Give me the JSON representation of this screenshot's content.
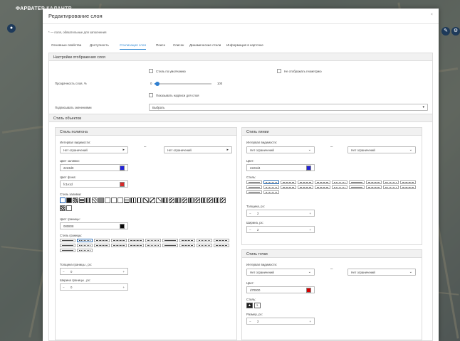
{
  "map": {
    "title": "ФАРВАТЕР КАЛАНТР"
  },
  "modal": {
    "title": "Редактирование слоя",
    "close_icon": "×",
    "required_note": "* — поля, обязательные для заполнения",
    "tabs": [
      {
        "label": "Основные свойства"
      },
      {
        "label": "Доступность"
      },
      {
        "label": "Стилизация слоя"
      },
      {
        "label": "Поиск"
      },
      {
        "label": "Список"
      },
      {
        "label": "Динамические стили"
      },
      {
        "label": "Информация в карточке"
      }
    ],
    "active_tab": "Стилизация слоя"
  },
  "display": {
    "title": "Настройки отображения слоя",
    "default_style": "Стиль по умолчанию",
    "hide_geometry": "Не отображать геометрию",
    "opacity_label": "Прозрачность слоя, %",
    "opacity_min": "0",
    "opacity_max": "100",
    "opacity_value": 0.04,
    "show_labels": "Показывать надписи для слоя",
    "sign_label": "Подписывать значениями",
    "sign_value": "Выбрать"
  },
  "objects": {
    "title": "Стиль объектов"
  },
  "polygon": {
    "title": "Стиль полигона",
    "visibility_label": "Интервал видимости:",
    "vis_from": "Нет ограничений",
    "vis_to": "Нет ограничений",
    "fill_label": "Цвет заливки:",
    "fill_value": "2223d9",
    "fill_color": "#2223d9",
    "bg_label": "Цвет фона:",
    "bg_value": "fc1e1d",
    "bg_color": "#d92b2b",
    "fillstyle_label": "Стиль заливки:",
    "border_color_label": "Цвет границы:",
    "border_color_value": "080808",
    "border_color": "#080808",
    "border_style_label": "Стиль границы:",
    "border_thickness_label": "Толщина границы , px:",
    "border_thickness_value": "0",
    "border_width_label": "Ширина границы , px:",
    "border_width_value": "0"
  },
  "line": {
    "title": "Стиль линии",
    "visibility_label": "Интервал видимости:",
    "vis_from": "Нет ограничений",
    "vis_to": "Нет ограничений",
    "color_label": "Цвет:",
    "color_value": "2223d4",
    "color": "#2223d4",
    "style_label": "Стиль:",
    "thickness_label": "Толщина, px:",
    "thickness_value": "2",
    "width_label": "Ширина, px:",
    "width_value": "2"
  },
  "point": {
    "title": "Стиль точки",
    "visibility_label": "Интервал видимости:",
    "vis_from": "Нет ограничений",
    "vis_to": "Нет ограничений",
    "color_label": "Цвет:",
    "color_value": "d70000",
    "color": "#d70000",
    "style_label": "Стиль:",
    "size_label": "Размер, px:",
    "size_value": "2"
  },
  "icons": {
    "dropdown": "chevron-down-icon",
    "minus": "−",
    "plus": "+"
  }
}
